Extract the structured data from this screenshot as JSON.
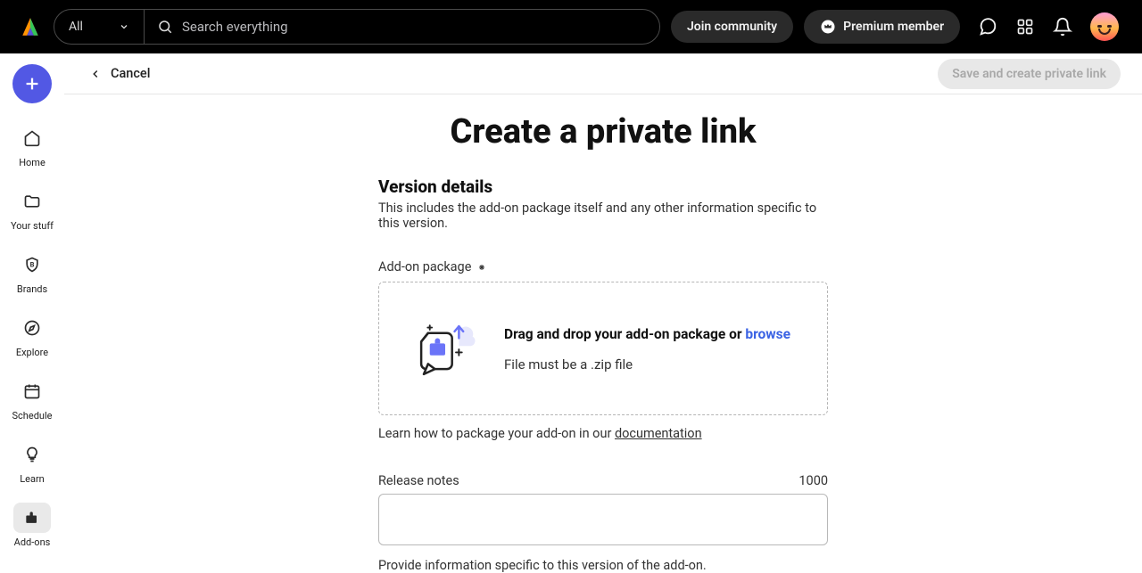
{
  "header": {
    "filter_label": "All",
    "search_placeholder": "Search everything",
    "join_label": "Join community",
    "premium_label": "Premium member"
  },
  "sidebar": {
    "items": [
      {
        "label": "Home"
      },
      {
        "label": "Your stuff"
      },
      {
        "label": "Brands"
      },
      {
        "label": "Explore"
      },
      {
        "label": "Schedule"
      },
      {
        "label": "Learn"
      },
      {
        "label": "Add-ons"
      }
    ]
  },
  "subheader": {
    "cancel_label": "Cancel",
    "submit_label": "Save and create private link"
  },
  "page": {
    "title": "Create a private link",
    "section_title": "Version details",
    "section_desc": "This includes the add-on package itself and any other information specific to this version.",
    "package_label": "Add-on package",
    "dropzone_strong_part1": "Drag and drop your add-on package or ",
    "dropzone_browse": "browse",
    "dropzone_sub": "File must be a .zip file",
    "help_prefix": "Learn how to package your add-on in our ",
    "help_link": "documentation",
    "notes_label": "Release notes",
    "notes_counter": "1000",
    "notes_help": "Provide information specific to this version of the add-on."
  }
}
